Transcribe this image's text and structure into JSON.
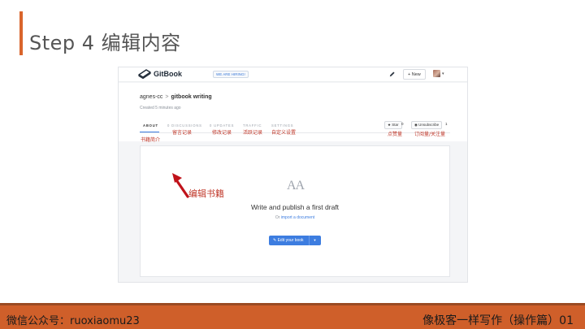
{
  "slide": {
    "title": "Step 4 编辑内容",
    "footer_left": "微信公众号：ruoxiaomu23",
    "footer_right": "像极客一样写作（操作篇）01",
    "accent_color": "#d9652c",
    "footer_color": "#cf5f2a"
  },
  "gitbook": {
    "topbar": {
      "logo_text": "GitBook",
      "hiring_badge": "WE ARE HIRING!",
      "new_button": "+ New",
      "icons": [
        "gitbook-logo-icon",
        "edit-pen-icon",
        "avatar"
      ]
    },
    "breadcrumb": {
      "owner": "agnes-cc",
      "separator": ">",
      "book": "gitbook writing"
    },
    "created": "Created 5 minutes ago",
    "tabs": [
      {
        "label": "ABOUT",
        "active": true
      },
      {
        "label": "0 DISCUSSIONS",
        "active": false
      },
      {
        "label": "0 UPDATES",
        "active": false
      },
      {
        "label": "TRAFFIC",
        "active": false
      },
      {
        "label": "SETTINGS",
        "active": false
      }
    ],
    "star": {
      "label": "★ Star",
      "count": "0"
    },
    "unsubscribe": {
      "label": "◉ Unsubscribe",
      "count": "1"
    },
    "empty_state": {
      "glyph": "AA",
      "heading": "Write and publish a first draft",
      "or_text": "Or ",
      "import_link": "import a document",
      "edit_button": "✎ Edit your book",
      "edit_caret": "▼"
    }
  },
  "annotations": {
    "about": "书籍简介",
    "discussions": "留言记录",
    "updates": "修改记录",
    "traffic": "活跃记录",
    "settings": "自定义设置",
    "star": "点赞量",
    "subscribe": "订阅量/关注量",
    "edit": "编辑书籍",
    "color": "#c0392b"
  }
}
